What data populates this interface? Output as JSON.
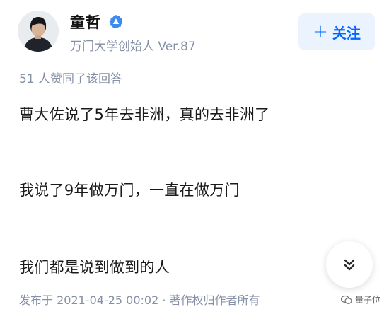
{
  "author": {
    "name": "童哲",
    "title": "万门大学创始人 Ver.87",
    "follow_label": "关注",
    "follow_icon": "plus-icon",
    "badge_icon": "verified-badge-icon"
  },
  "answer": {
    "upvote_note": "51 人赞同了该回答",
    "paragraphs": [
      "曹大佐说了5年去非洲，真的去非洲了",
      "我说了9年做万门，一直在做万门",
      "我们都是说到做到的人"
    ],
    "meta": "发布于 2021-04-25 00:02 · 著作权归作者所有"
  },
  "controls": {
    "expand_icon": "double-chevron-down-icon"
  },
  "watermark": {
    "text": "量子位"
  },
  "colors": {
    "accent": "#0066ff",
    "follow_bg": "#ebf3ff",
    "muted_text": "#8590a6",
    "body_text": "#1a1a1a"
  }
}
